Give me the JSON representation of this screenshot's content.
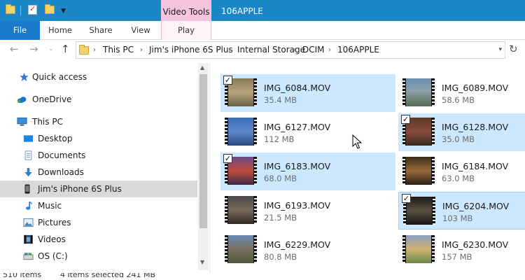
{
  "titlebar": {
    "context_tab": "Video Tools",
    "window_title": "106APPLE",
    "color": "#1b87c9",
    "context_color": "#f6c4df"
  },
  "ribbon": {
    "tabs": [
      "File",
      "Home",
      "Share",
      "View",
      "Play"
    ]
  },
  "address": {
    "crumbs": [
      "This PC",
      "Jim's iPhone 6S Plus",
      "Internal Storage",
      "DCIM",
      "106APPLE"
    ]
  },
  "sidebar": {
    "items": [
      {
        "label": "Quick access",
        "icon": "star-icon"
      },
      {
        "label": "OneDrive",
        "icon": "cloud-icon"
      },
      {
        "label": "This PC",
        "icon": "computer-icon"
      },
      {
        "label": "Desktop",
        "icon": "desktop-icon"
      },
      {
        "label": "Documents",
        "icon": "document-icon"
      },
      {
        "label": "Downloads",
        "icon": "download-icon"
      },
      {
        "label": "Jim's iPhone 6S Plus",
        "icon": "phone-icon",
        "selected": true
      },
      {
        "label": "Music",
        "icon": "music-icon"
      },
      {
        "label": "Pictures",
        "icon": "pictures-icon"
      },
      {
        "label": "Videos",
        "icon": "videos-icon"
      },
      {
        "label": "OS (C:)",
        "icon": "drive-icon"
      }
    ]
  },
  "files": [
    {
      "name": "IMG_6084.MOV",
      "size": "35.4 MB",
      "selected": true
    },
    {
      "name": "IMG_6089.MOV",
      "size": "58.6 MB",
      "selected": false
    },
    {
      "name": "IMG_6127.MOV",
      "size": "112 MB",
      "selected": false
    },
    {
      "name": "IMG_6128.MOV",
      "size": "35.0 MB",
      "selected": true
    },
    {
      "name": "IMG_6183.MOV",
      "size": "68.0 MB",
      "selected": true
    },
    {
      "name": "IMG_6184.MOV",
      "size": "63.0 MB",
      "selected": false
    },
    {
      "name": "IMG_6193.MOV",
      "size": "21.5 MB",
      "selected": false
    },
    {
      "name": "IMG_6204.MOV",
      "size": "103 MB",
      "selected": true
    },
    {
      "name": "IMG_6229.MOV",
      "size": "80.8 MB",
      "selected": false
    },
    {
      "name": "IMG_6230.MOV",
      "size": "157 MB",
      "selected": false
    }
  ],
  "status": {
    "item_count": "510 items",
    "selection": "4 items selected  241 MB"
  }
}
